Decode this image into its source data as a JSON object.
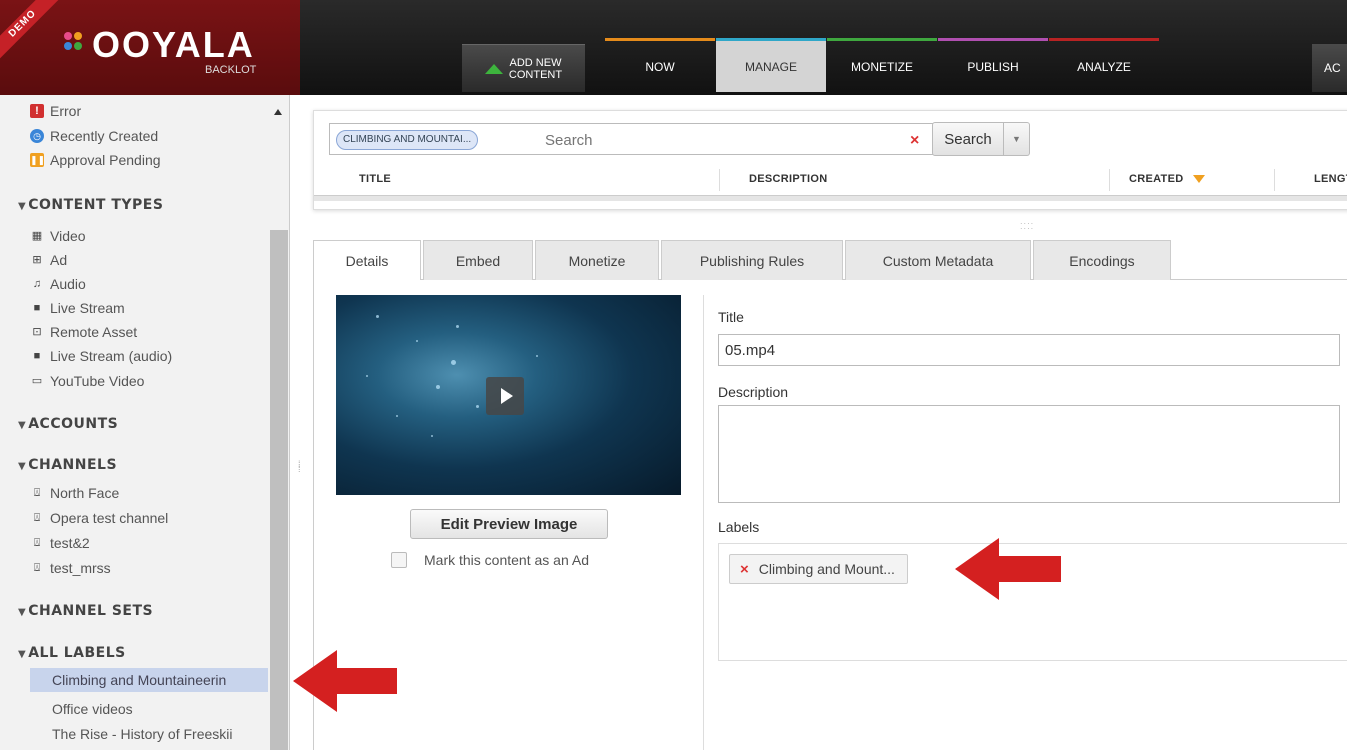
{
  "header": {
    "demo": "DEMO",
    "logo_text": "OOYALA",
    "logo_sub": "BACKLOT",
    "add_new_line1": "ADD NEW",
    "add_new_line2": "CONTENT",
    "tabs": [
      "NOW",
      "MANAGE",
      "MONETIZE",
      "PUBLISH",
      "ANALYZE"
    ],
    "account_tab": "AC"
  },
  "sidebar": {
    "filters": [
      "Error",
      "Recently Created",
      "Approval Pending"
    ],
    "content_types_heading": "CONTENT TYPES",
    "content_types": [
      "Video",
      "Ad",
      "Audio",
      "Live Stream",
      "Remote Asset",
      "Live Stream (audio)",
      "YouTube Video"
    ],
    "accounts_heading": "ACCOUNTS",
    "channels_heading": "CHANNELS",
    "channels": [
      "North Face",
      "Opera test channel",
      "test&2",
      "test_mrss"
    ],
    "channel_sets_heading": "CHANNEL SETS",
    "all_labels_heading": "ALL LABELS",
    "labels": [
      "Climbing and Mountaineerin",
      "Office videos",
      "The Rise - History of Freeskii"
    ]
  },
  "search": {
    "chip": "CLIMBING AND MOUNTAI...",
    "placeholder": "Search",
    "clear": "×",
    "button": "Search",
    "columns": [
      "TITLE",
      "DESCRIPTION",
      "CREATED",
      "LENGT"
    ]
  },
  "detail_tabs": [
    "Details",
    "Embed",
    "Monetize",
    "Publishing Rules",
    "Custom Metadata",
    "Encodings"
  ],
  "details": {
    "edit_preview": "Edit Preview Image",
    "mark_ad": "Mark this content as an Ad",
    "title_label": "Title",
    "title_value": "05.mp4",
    "description_label": "Description",
    "labels_label": "Labels",
    "label_chip": "Climbing and Mount...",
    "label_chip_x": "×"
  },
  "colors": {
    "accent_now": "#e58b1b",
    "accent_manage": "#2fa7c8",
    "accent_monetize": "#3fa83f",
    "accent_publish": "#b04fb0",
    "accent_analyze": "#b82323",
    "arrow": "#d42020",
    "selected_label_bg": "#c8d4ec"
  }
}
